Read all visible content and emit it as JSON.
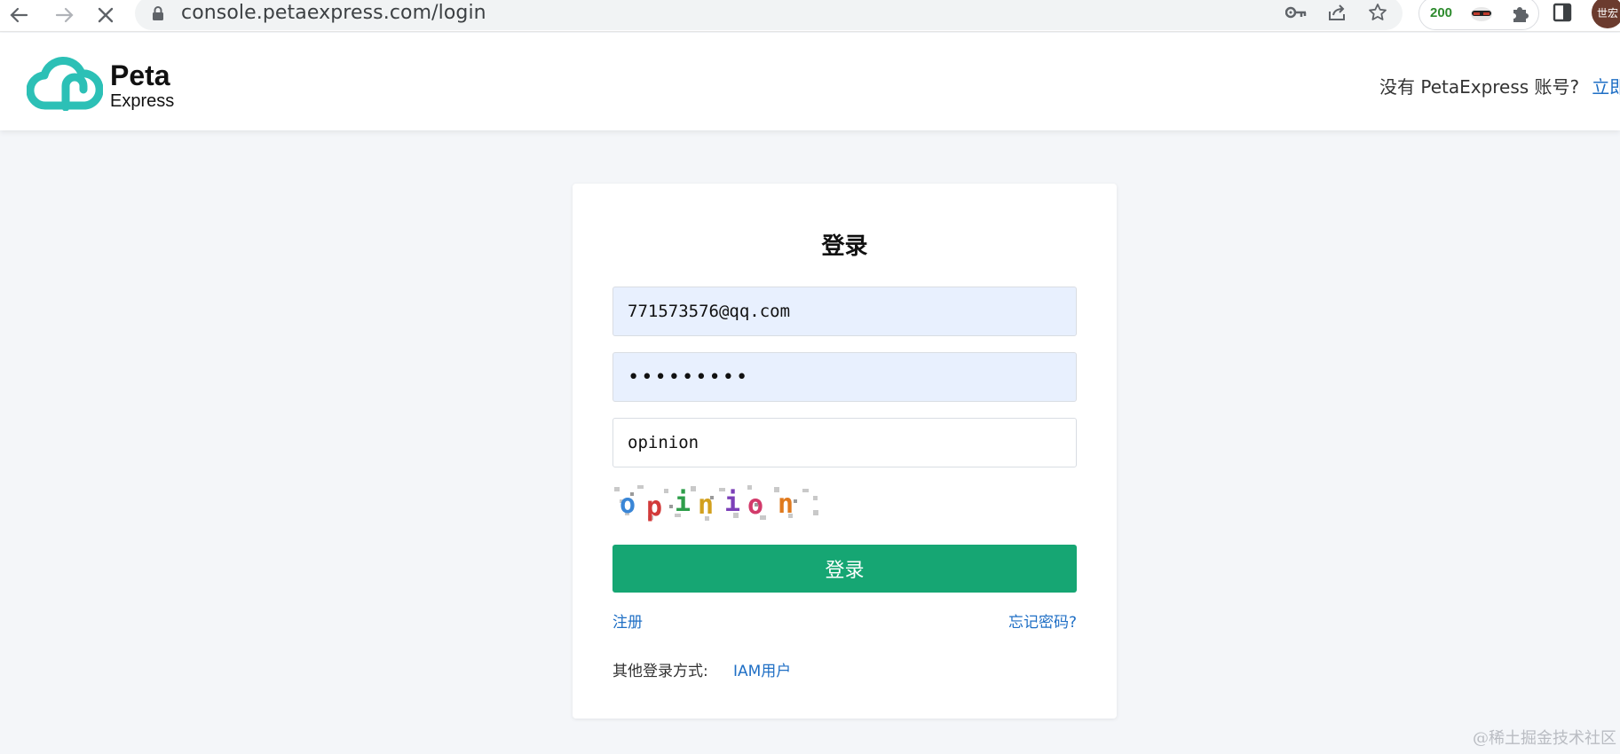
{
  "browser": {
    "url": "console.petaexpress.com/login",
    "extension_badge": "200",
    "profile_label": "世宏"
  },
  "header": {
    "logo_line1": "Peta",
    "logo_line2": "Express",
    "no_account_text": "没有 PetaExpress 账号?",
    "signup_link": "立即"
  },
  "login": {
    "title": "登录",
    "email_value": "771573576@qq.com",
    "password_masked": "•••••••••",
    "captcha_value": "opinion",
    "captcha_image_text": "opinion",
    "submit_label": "登录",
    "register_label": "注册",
    "forgot_label": "忘记密码?",
    "other_methods_label": "其他登录方式:",
    "iam_label": "IAM用户"
  },
  "watermark": "@稀土掘金技术社区",
  "colors": {
    "primary_green": "#16a673",
    "link_blue": "#1f6fc5",
    "logo_teal": "#2cc0b6",
    "autofill_bg": "#e8f0fe"
  }
}
